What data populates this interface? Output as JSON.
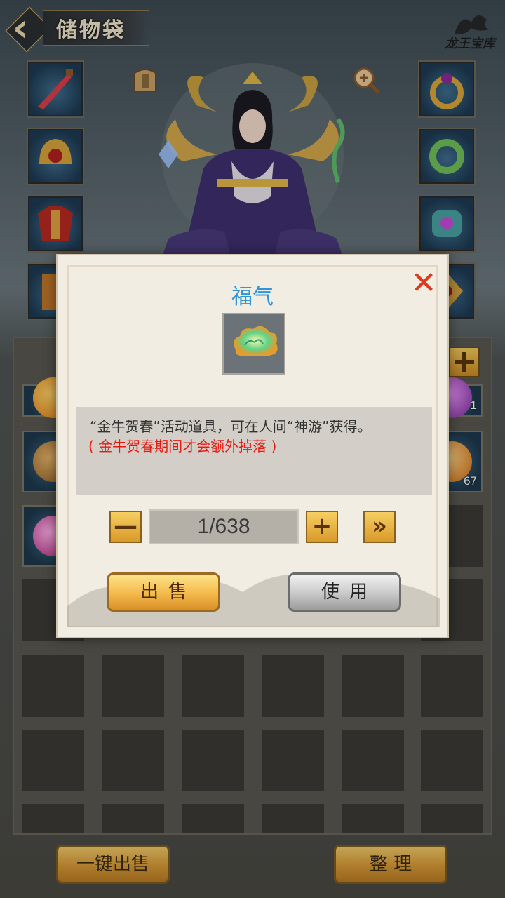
{
  "header": {
    "title": "储物袋",
    "logo_text": "龙王宝库"
  },
  "equipment": {
    "left": [
      "sword-icon",
      "helmet-icon",
      "armor-icon",
      "boots-icon"
    ],
    "right": [
      "ring-icon",
      "necklace-icon",
      "bracelet-icon",
      "amulet-icon"
    ]
  },
  "inventory": {
    "visible_counts": [
      "1",
      "67"
    ]
  },
  "bottom_bar": {
    "sell_all_label": "一键出售",
    "sort_label": "整 理"
  },
  "dialog": {
    "title": "福气",
    "description": "“金牛贺春”活动道具，可在人间“神游”获得。",
    "note": "( 金牛贺春期间才会额外掉落 )",
    "quantity": "1/638",
    "minus_label": "—",
    "plus_label": "+",
    "max_label": "»",
    "sell_label": "出售",
    "use_label": "使用",
    "close_label": "✕"
  },
  "colors": {
    "title_blue": "#2f95d8",
    "note_red": "#e81a10",
    "gold_button": "#f3b94a"
  }
}
